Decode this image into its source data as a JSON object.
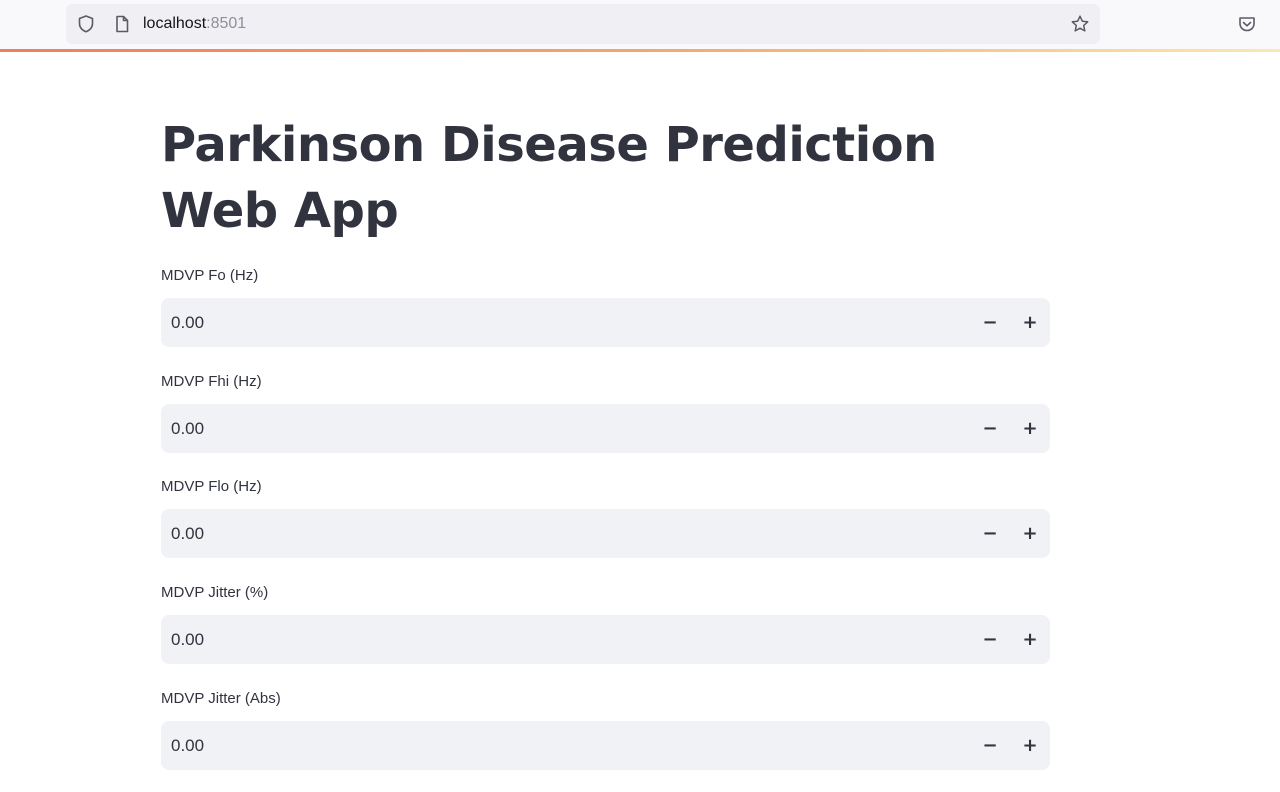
{
  "browser": {
    "url_host": "localhost",
    "url_port": ":8501",
    "icons": [
      "shield-icon",
      "page-icon",
      "star-icon",
      "pocket-icon"
    ],
    "loading_bar_colors": [
      "#ee7f5c",
      "#f4a66a",
      "#fbe8b0"
    ]
  },
  "page": {
    "title": "Parkinson Disease Prediction Web App"
  },
  "fields": [
    {
      "label": "MDVP Fo (Hz)",
      "value": "0.00",
      "minus": "−",
      "plus": "+"
    },
    {
      "label": "MDVP Fhi (Hz)",
      "value": "0.00",
      "minus": "−",
      "plus": "+"
    },
    {
      "label": "MDVP Flo (Hz)",
      "value": "0.00",
      "minus": "−",
      "plus": "+"
    },
    {
      "label": "MDVP Jitter (%)",
      "value": "0.00",
      "minus": "−",
      "plus": "+"
    },
    {
      "label": "MDVP Jitter (Abs)",
      "value": "0.00",
      "minus": "−",
      "plus": "+"
    }
  ],
  "colors": {
    "text": "#31333f",
    "input_background": "#f0f2f6"
  }
}
